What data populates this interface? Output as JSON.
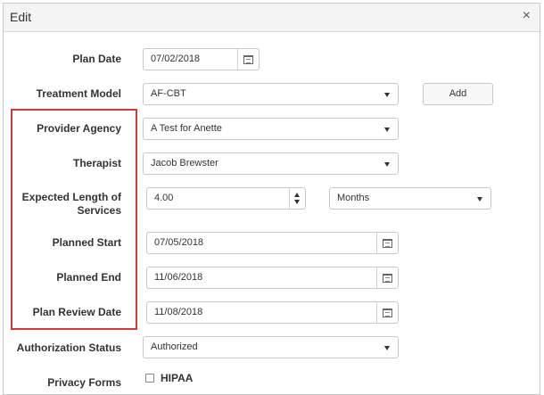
{
  "dialog": {
    "title": "Edit",
    "close_glyph": "×"
  },
  "form": {
    "plan_date": {
      "label": "Plan Date",
      "value": "07/02/2018"
    },
    "treatment_model": {
      "label": "Treatment Model",
      "value": "AF-CBT",
      "add_label": "Add"
    },
    "provider_agency": {
      "label": "Provider Agency",
      "value": "A Test for Anette"
    },
    "therapist": {
      "label": "Therapist",
      "value": "Jacob Brewster"
    },
    "expected_length": {
      "label_line1": "Expected Length of",
      "label_line2": "Services",
      "value": "4.00",
      "unit": "Months"
    },
    "planned_start": {
      "label": "Planned Start",
      "value": "07/05/2018"
    },
    "planned_end": {
      "label": "Planned End",
      "value": "11/06/2018"
    },
    "plan_review_date": {
      "label": "Plan Review Date",
      "value": "11/08/2018"
    },
    "authorization_status": {
      "label": "Authorization Status",
      "value": "Authorized"
    },
    "privacy_forms": {
      "label": "Privacy Forms",
      "option_hipaa": "HIPAA"
    }
  },
  "colors": {
    "highlight": "#d23a3a"
  }
}
